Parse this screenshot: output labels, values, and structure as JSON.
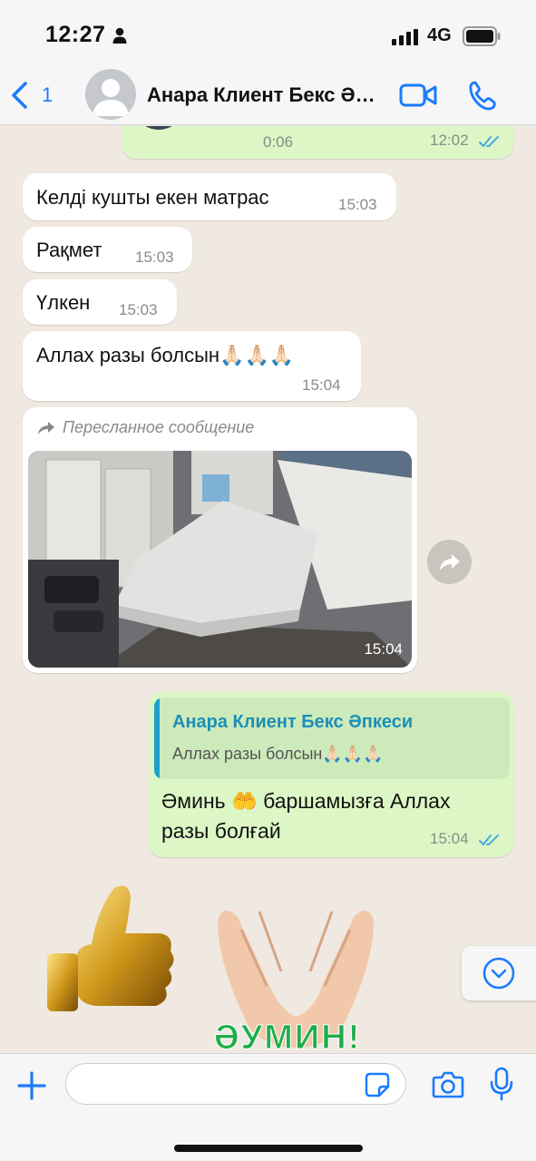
{
  "status_bar": {
    "time": "12:27",
    "network": "4G"
  },
  "header": {
    "back_count": "1",
    "contact_name": "Анара Клиент Бекс Әпкеси"
  },
  "messages": [
    {
      "direction": "out",
      "type": "voice",
      "duration": "0:06",
      "time": "12:02",
      "status": "read"
    },
    {
      "direction": "in",
      "text": "Келді кушты екен матрас",
      "time": "15:03"
    },
    {
      "direction": "in",
      "text": "Рақмет",
      "time": "15:03"
    },
    {
      "direction": "in",
      "text": "Үлкен",
      "time": "15:03"
    },
    {
      "direction": "in",
      "text": "Аллах разы болсын🙏🏻🙏🏻🙏🏻",
      "time": "15:04"
    },
    {
      "direction": "in",
      "type": "photo",
      "forwarded_label": "Пересланное сообщение",
      "time": "15:04"
    },
    {
      "direction": "out",
      "reply_to": {
        "author": "Анара Клиент Бекс Әпкеси",
        "text": "Аллах разы болсын🙏🏻🙏🏻🙏🏻"
      },
      "text_lines": [
        "Әминь 🤲 баршамызға Аллах",
        "разы болғай"
      ],
      "time": "15:04",
      "status": "read"
    },
    {
      "direction": "in",
      "type": "stickers",
      "caption": "ӘУМИН!"
    }
  ],
  "input_bar": {
    "placeholder": ""
  },
  "colors": {
    "accent": "#1a7bff",
    "outgoing_bubble": "#dcf7c5",
    "incoming_bubble": "#ffffff",
    "read_ticks": "#34a4e0",
    "chat_bg": "#efe9e1"
  },
  "icons": [
    "back-chevron-icon",
    "video-camera-icon",
    "phone-icon",
    "forward-arrow-icon",
    "chevron-down-icon",
    "plus-icon",
    "sticker-icon",
    "camera-icon",
    "microphone-icon"
  ]
}
